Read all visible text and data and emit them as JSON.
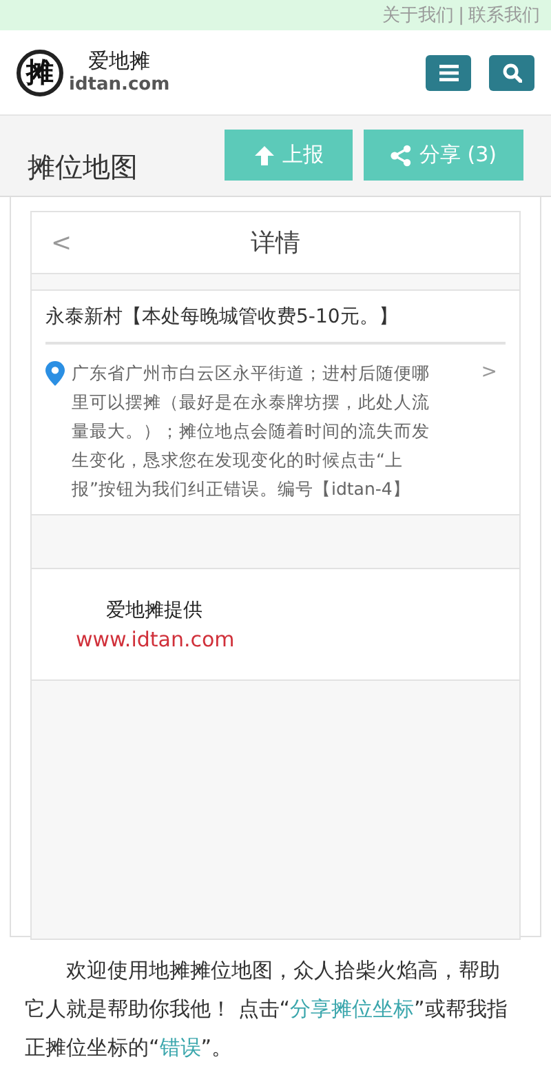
{
  "top_links": [
    {
      "label": "关于我们"
    },
    {
      "label": "联系我们"
    }
  ],
  "top_separator": "|",
  "logo": {
    "mark": "摊",
    "name": "爱地摊",
    "domain": "idtan.com"
  },
  "header_buttons": [
    {
      "kind": "menu"
    },
    {
      "kind": "search"
    }
  ],
  "page_title": "摊位地图",
  "actions": [
    {
      "kind": "report",
      "label": "上报"
    },
    {
      "kind": "share",
      "label": "分享 (3)"
    }
  ],
  "detail": {
    "back": "<",
    "title": "详情",
    "spot": {
      "name": "永泰新村【本处每晚城管收费5-10元。】",
      "address": "广东省广州市白云区永平街道；进村后随便哪里可以摆摊（最好是在永泰牌坊摆，此处人流量最大。）；摊位地点会随着时间的流失而发生变化，恳求您在发现变化的时候点击“上报”按钮为我们纠正错误。编号【idtan-4】",
      "chevron": ">"
    },
    "provider": {
      "text": "爱地摊提供",
      "url": "www.idtan.com"
    }
  },
  "intro": [
    {
      "kind": "text",
      "text": "欢迎使用地摊摊位地图，众人拾柴火焰高，帮助它人就是帮助你我他！ 点击“"
    },
    {
      "kind": "link",
      "text": "分享摊位坐标"
    },
    {
      "kind": "text",
      "text": "”或帮我指正摊位坐标的“"
    },
    {
      "kind": "link",
      "text": "错误"
    },
    {
      "kind": "text",
      "text": "”。"
    }
  ]
}
